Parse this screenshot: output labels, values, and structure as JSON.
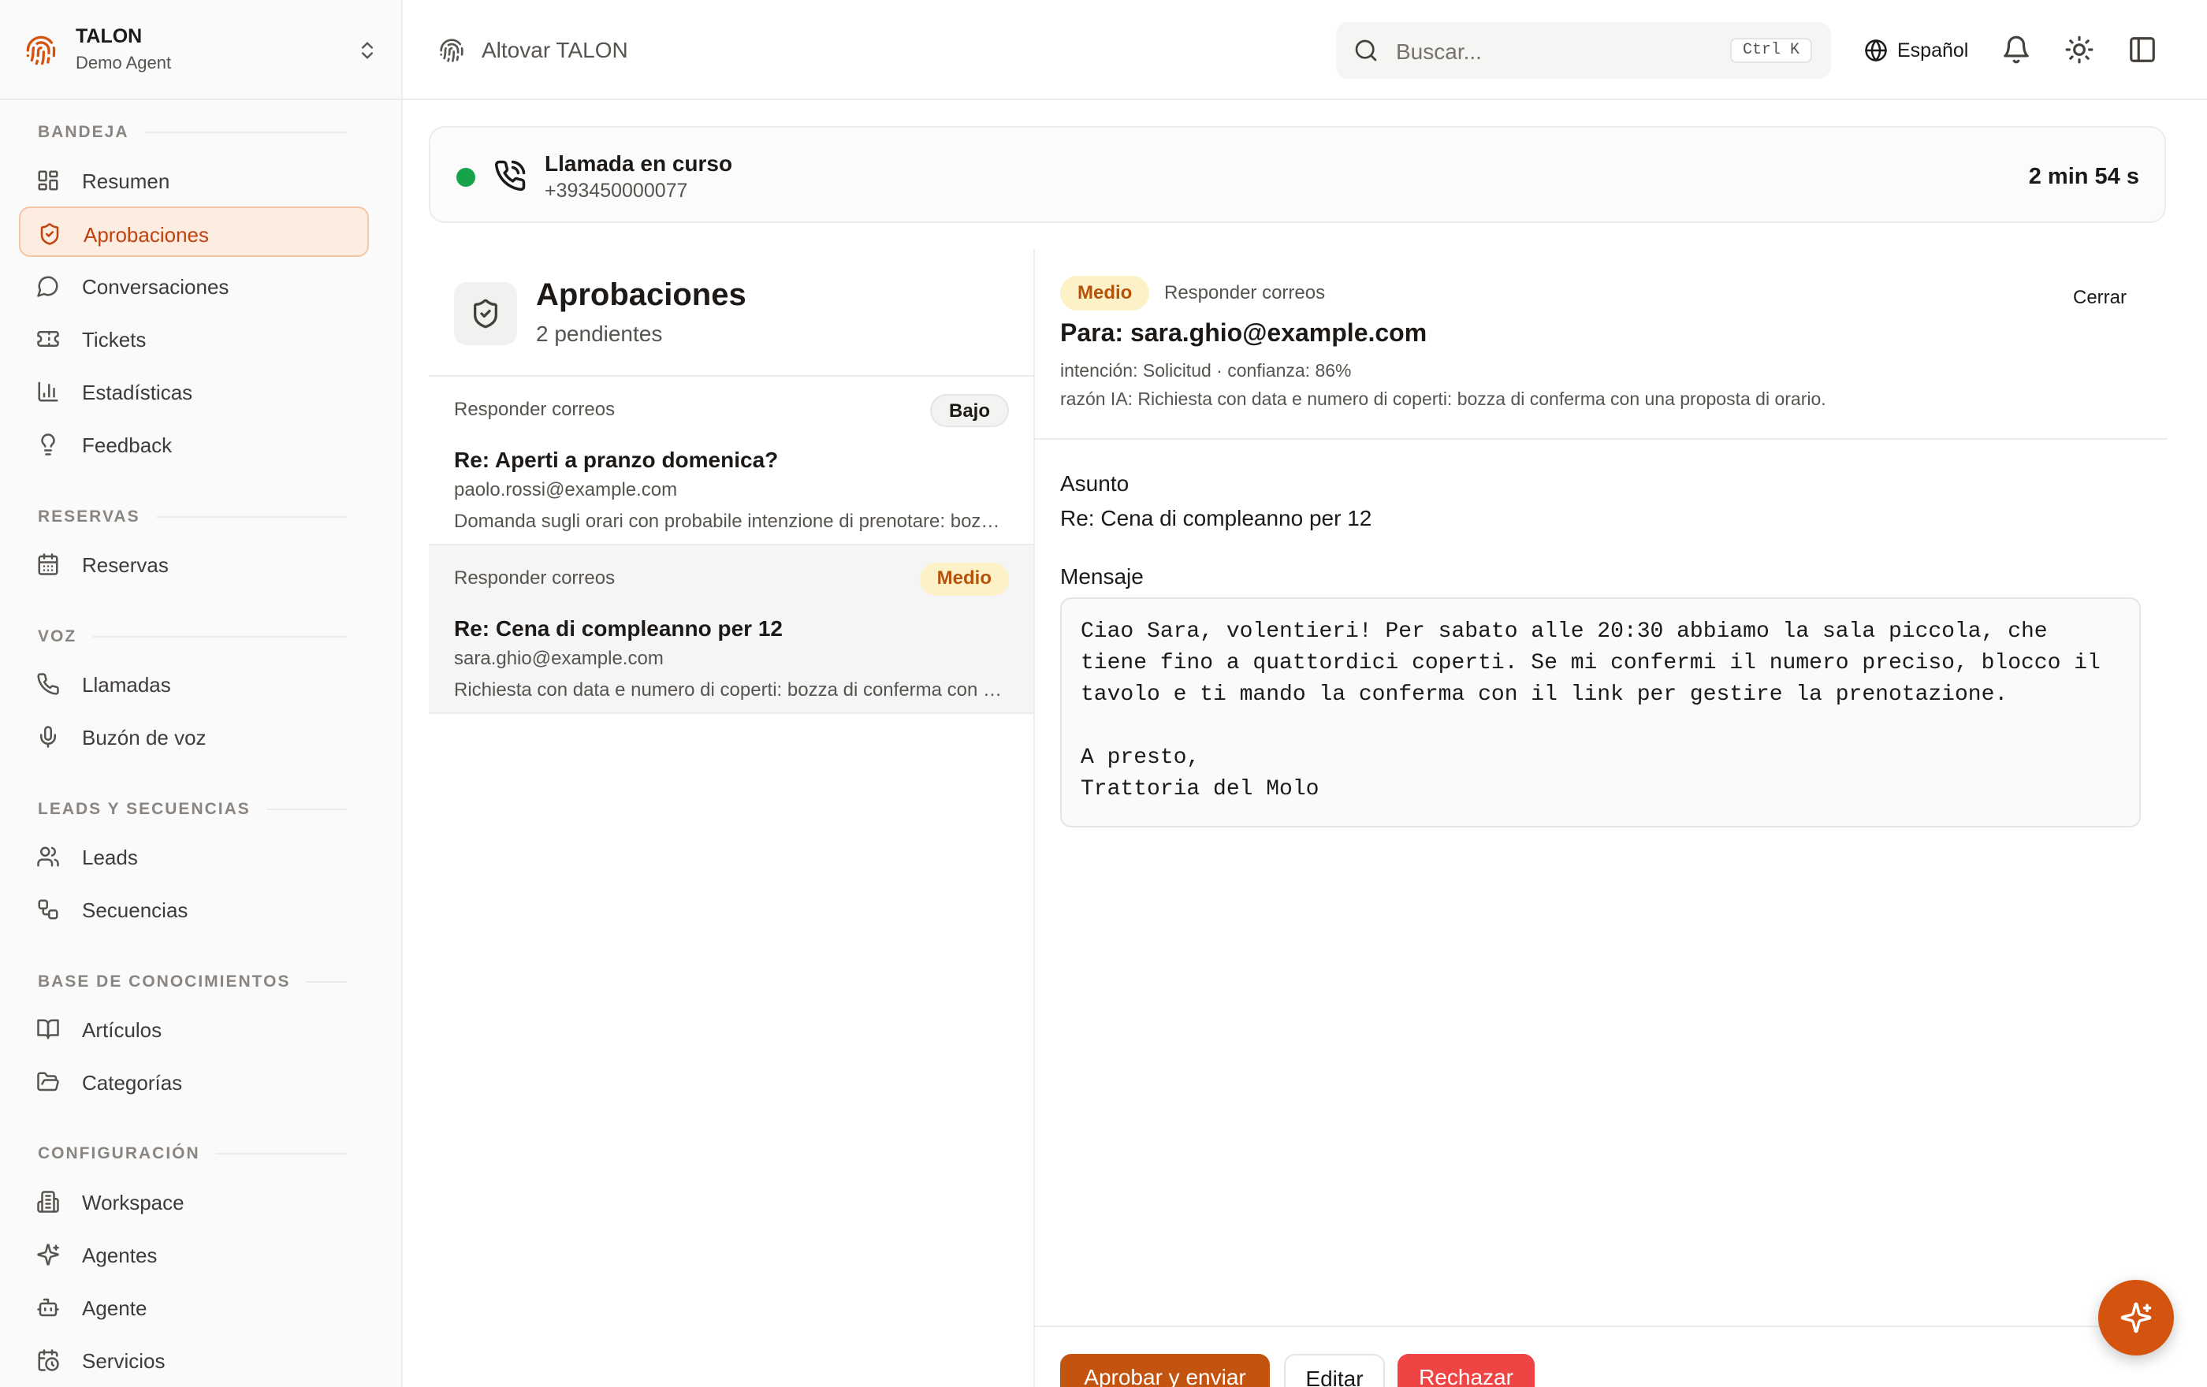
{
  "workspace": {
    "name": "TALON",
    "subtitle": "Demo Agent"
  },
  "sidebar": {
    "sections": [
      {
        "title": "BANDEJA",
        "items": [
          {
            "label": "Resumen",
            "icon": "dashboard-icon"
          },
          {
            "label": "Aprobaciones",
            "icon": "shield-check-icon",
            "active": true
          },
          {
            "label": "Conversaciones",
            "icon": "chat-bubble-icon"
          },
          {
            "label": "Tickets",
            "icon": "ticket-icon"
          },
          {
            "label": "Estadísticas",
            "icon": "bar-chart-icon"
          },
          {
            "label": "Feedback",
            "icon": "lightbulb-icon"
          }
        ]
      },
      {
        "title": "RESERVAS",
        "items": [
          {
            "label": "Reservas",
            "icon": "calendar-icon"
          }
        ]
      },
      {
        "title": "VOZ",
        "items": [
          {
            "label": "Llamadas",
            "icon": "phone-icon"
          },
          {
            "label": "Buzón de voz",
            "icon": "microphone-icon"
          }
        ]
      },
      {
        "title": "LEADS Y SECUENCIAS",
        "items": [
          {
            "label": "Leads",
            "icon": "users-icon"
          },
          {
            "label": "Secuencias",
            "icon": "workflow-icon"
          }
        ]
      },
      {
        "title": "BASE DE CONOCIMIENTOS",
        "items": [
          {
            "label": "Artículos",
            "icon": "book-icon"
          },
          {
            "label": "Categorías",
            "icon": "folder-icon"
          }
        ]
      },
      {
        "title": "CONFIGURACIÓN",
        "items": [
          {
            "label": "Workspace",
            "icon": "building-icon"
          },
          {
            "label": "Agentes",
            "icon": "sparkles-icon"
          },
          {
            "label": "Agente",
            "icon": "bot-icon"
          },
          {
            "label": "Servicios",
            "icon": "calendar-clock-icon"
          }
        ]
      }
    ]
  },
  "topbar": {
    "title": "Altovar TALON",
    "search_placeholder": "Buscar...",
    "search_shortcut": "Ctrl K",
    "language": "Español"
  },
  "call": {
    "title": "Llamada en curso",
    "number": "+393450000077",
    "duration": "2 min 54 s",
    "status_color": "#16a34a"
  },
  "approvals": {
    "title": "Aprobaciones",
    "count_label": "2 pendientes",
    "items": [
      {
        "category": "Responder correos",
        "priority": "Bajo",
        "subject": "Re: Aperti a pranzo domenica?",
        "from": "paolo.rossi@example.com",
        "preview": "Domanda sugli orari con probabile intenzione di prenotare: bozza di risposta con gli orari di apertura."
      },
      {
        "category": "Responder correos",
        "priority": "Medio",
        "subject": "Re: Cena di compleanno per 12",
        "from": "sara.ghio@example.com",
        "preview": "Richiesta con data e numero di coperti: bozza di conferma con una proposta di orario.",
        "selected": true
      }
    ]
  },
  "detail": {
    "priority": "Medio",
    "category": "Responder correos",
    "close_label": "Cerrar",
    "to": "Para: sara.ghio@example.com",
    "meta": "intención: Solicitud · confianza: 86%",
    "reason": "razón IA: Richiesta con data e numero di coperti: bozza di conferma con una proposta di orario.",
    "subject_label": "Asunto",
    "subject": "Re: Cena di compleanno per 12",
    "message_label": "Mensaje",
    "message": "Ciao Sara, volentieri! Per sabato alle 20:30 abbiamo la sala piccola, che\ntiene fino a quattordici coperti. Se mi confermi il numero preciso, blocco il\ntavolo e ti mando la conferma con il link per gestire la prenotazione.\n\nA presto,\nTrattoria del Molo",
    "buttons": {
      "approve": "Aprobar y enviar",
      "edit": "Editar",
      "reject": "Rechazar"
    }
  },
  "colors": {
    "accent": "#c2540f",
    "medium_badge_bg": "#fdf1c7",
    "medium_badge_text": "#b45309",
    "danger": "#ef4444"
  },
  "icons": {
    "fab": "sparkles-icon"
  }
}
